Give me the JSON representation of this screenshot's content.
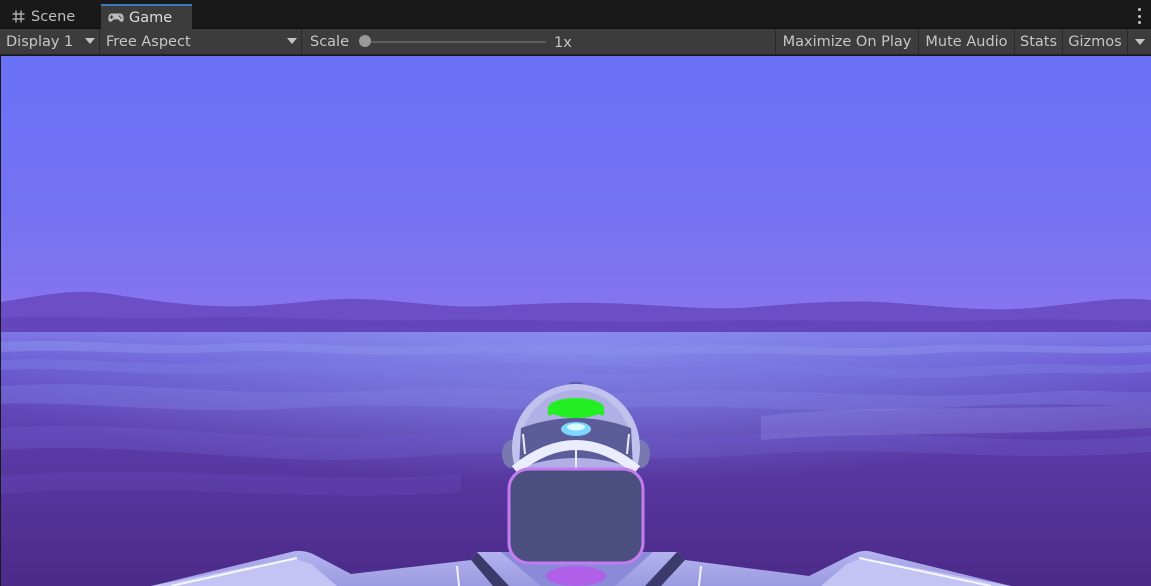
{
  "tabs": [
    {
      "label": "Scene",
      "icon": "grid-hash-icon",
      "active": false
    },
    {
      "label": "Game",
      "icon": "gamepad-icon",
      "active": true
    }
  ],
  "toolbar": {
    "display": {
      "label": "Display 1"
    },
    "aspect": {
      "label": "Free Aspect"
    },
    "scale": {
      "label": "Scale",
      "value": "1x",
      "level": 0
    },
    "maximize_on_play": "Maximize On Play",
    "mute_audio": "Mute Audio",
    "stats": "Stats",
    "gizmos": "Gizmos"
  },
  "colors": {
    "sky_top": "#6c70f4",
    "sky_horizon": "#8c74f0",
    "mountains": "#6a4cc0",
    "water_far": "#7b6ee0",
    "water_deep": "#4a2a85",
    "hull": "#a9a9e8",
    "robot_visor": "#4d5080",
    "robot_outline": "#c27bf1",
    "status_light": "#22ee22",
    "active_tab_accent": "#3a79bb"
  }
}
